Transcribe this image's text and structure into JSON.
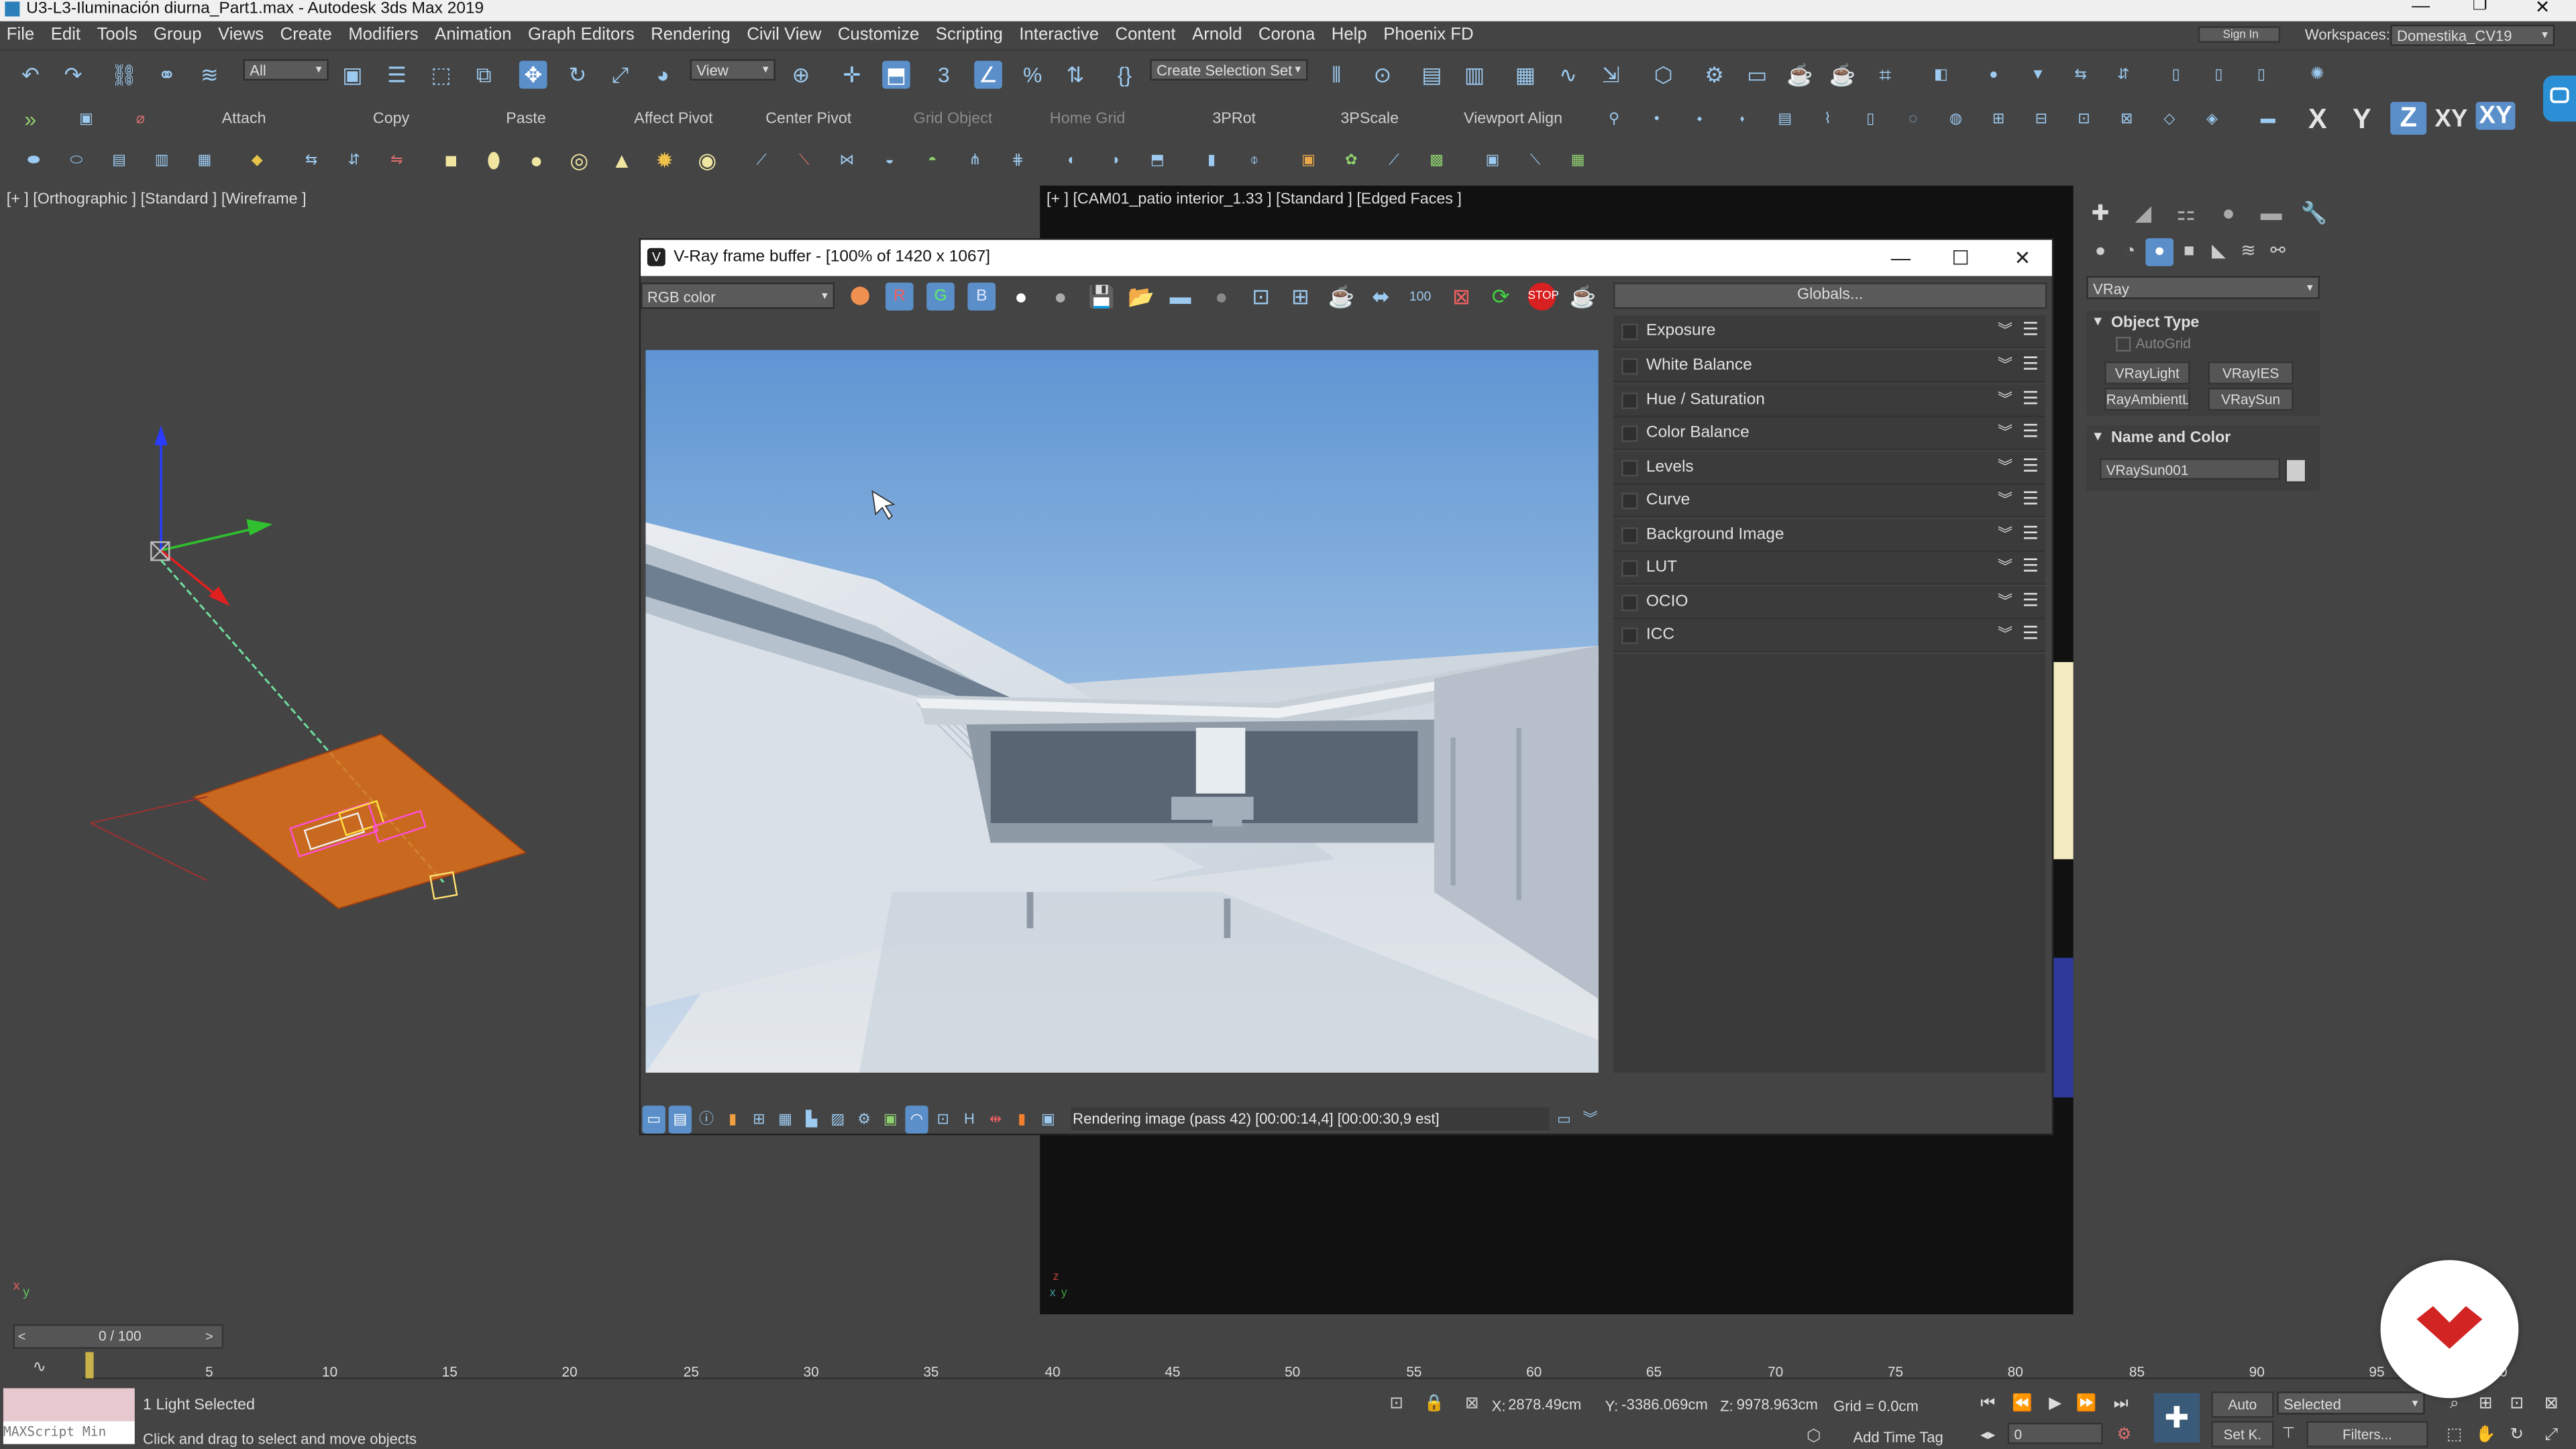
{
  "window": {
    "title": "U3-L3-Iluminación diurna_Part1.max - Autodesk 3ds Max 2019"
  },
  "menu": [
    "File",
    "Edit",
    "Tools",
    "Group",
    "Views",
    "Create",
    "Modifiers",
    "Animation",
    "Graph Editors",
    "Rendering",
    "Civil View",
    "Customize",
    "Scripting",
    "Interactive",
    "Content",
    "Arnold",
    "Corona",
    "Help",
    "Phoenix FD"
  ],
  "workspace": {
    "label": "Workspaces:",
    "value": "Domestika_CV19",
    "signin": "Sign In"
  },
  "toolbar": {
    "selection_filter": "All",
    "ref_coord": "View",
    "create_selection_set": "Create Selection Set",
    "labels": {
      "attach": "Attach",
      "copy": "Copy",
      "paste": "Paste",
      "affect_pivot": "Affect Pivot",
      "center_pivot": "Center Pivot",
      "grid_object": "Grid Object",
      "home_grid": "Home Grid",
      "rot3p": "3PRot",
      "scale3p": "3PScale",
      "viewport_align": "Viewport Align"
    },
    "axes": [
      "X",
      "Y",
      "Z",
      "XY",
      "XY"
    ]
  },
  "viewport_left": {
    "label": "[+ ] [Orthographic ] [Standard ] [Wireframe ]"
  },
  "viewport_right": {
    "label": "[+ ] [CAM01_patio interior_1.33 ] [Standard ] [Edged Faces ]"
  },
  "vfb": {
    "title": "V-Ray frame buffer - [100% of 1420 x 1067]",
    "channel": "RGB color",
    "rgb_buttons": [
      "R",
      "G",
      "B"
    ],
    "globals": "Globals...",
    "corrections": [
      "Exposure",
      "White Balance",
      "Hue / Saturation",
      "Color Balance",
      "Levels",
      "Curve",
      "Background Image",
      "LUT",
      "OCIO",
      "ICC"
    ],
    "status": "Rendering image (pass 42) [00:00:14,4] [00:00:30,9 est]"
  },
  "command_panel": {
    "renderer": "VRay",
    "object_type_header": "Object Type",
    "autogrid": "AutoGrid",
    "buttons": [
      "VRayLight",
      "VRayIES",
      "RayAmbientLig",
      "VRaySun"
    ],
    "name_color_header": "Name and Color",
    "object_name": "VRaySun001",
    "object_color": "#cfcfcf"
  },
  "timeline": {
    "frame_display": "0 / 100",
    "ticks": [
      "5",
      "10",
      "15",
      "20",
      "25",
      "30",
      "35",
      "40",
      "45",
      "50",
      "55",
      "60",
      "65",
      "70",
      "75",
      "80",
      "85",
      "90",
      "95",
      "100"
    ]
  },
  "status": {
    "selection": "1 Light Selected",
    "prompt": "Click and drag to select and move objects",
    "maxscript": "MAXScript Min",
    "x_label": "X:",
    "x": "2878.49cm",
    "y_label": "Y:",
    "y": "-3386.069cm",
    "z_label": "Z:",
    "z": "9978.963cm",
    "grid": "Grid = 0.0cm",
    "add_time_tag": "Add Time Tag",
    "auto": "Auto",
    "set_key": "Set K.",
    "selected": "Selected",
    "filters": "Filters...",
    "current_frame": "0"
  },
  "colors": {
    "accent": "#5b8fc9",
    "brand_badge": "#d32424"
  }
}
